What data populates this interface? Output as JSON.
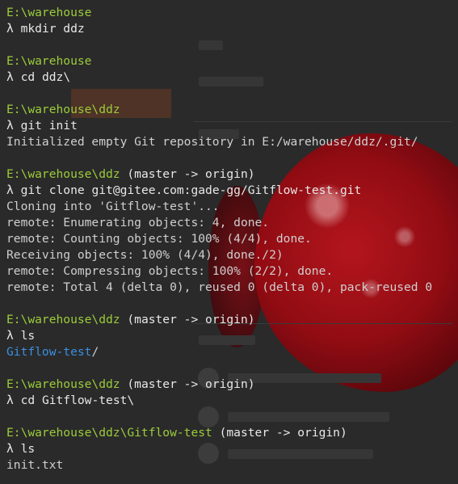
{
  "window": {
    "prompt_symbol": "λ"
  },
  "colors": {
    "background": "#2a2a2a",
    "path": "#9ccc3a",
    "text": "#d6d6d6",
    "directory": "#3b8fe0",
    "apple_red": "#c0141c"
  },
  "session": [
    {
      "type": "path",
      "path": "E:\\warehouse",
      "branch": ""
    },
    {
      "type": "cmd",
      "text": "mkdir ddz"
    },
    {
      "type": "blank"
    },
    {
      "type": "path",
      "path": "E:\\warehouse",
      "branch": ""
    },
    {
      "type": "cmd",
      "text": "cd ddz\\"
    },
    {
      "type": "blank"
    },
    {
      "type": "path",
      "path": "E:\\warehouse\\ddz",
      "branch": ""
    },
    {
      "type": "cmd",
      "text": "git init"
    },
    {
      "type": "out",
      "text": "Initialized empty Git repository in E:/warehouse/ddz/.git/"
    },
    {
      "type": "blank"
    },
    {
      "type": "path",
      "path": "E:\\warehouse\\ddz",
      "branch": " (master -> origin)"
    },
    {
      "type": "cmd",
      "text": "git clone git@gitee.com:gade-gg/Gitflow-test.git"
    },
    {
      "type": "out",
      "text": "Cloning into 'Gitflow-test'..."
    },
    {
      "type": "out",
      "text": "remote: Enumerating objects: 4, done."
    },
    {
      "type": "out",
      "text": "remote: Counting objects: 100% (4/4), done."
    },
    {
      "type": "out",
      "text": "Receiving objects: 100% (4/4), done./2)"
    },
    {
      "type": "out",
      "text": "remote: Compressing objects: 100% (2/2), done."
    },
    {
      "type": "out",
      "text": "remote: Total 4 (delta 0), reused 0 (delta 0), pack-reused 0"
    },
    {
      "type": "blank"
    },
    {
      "type": "path",
      "path": "E:\\warehouse\\ddz",
      "branch": " (master -> origin)"
    },
    {
      "type": "cmd",
      "text": "ls"
    },
    {
      "type": "dir",
      "name": "Gitflow-test",
      "suffix": "/"
    },
    {
      "type": "blank"
    },
    {
      "type": "path",
      "path": "E:\\warehouse\\ddz",
      "branch": " (master -> origin)"
    },
    {
      "type": "cmd",
      "text": "cd Gitflow-test\\"
    },
    {
      "type": "blank"
    },
    {
      "type": "path",
      "path": "E:\\warehouse\\ddz\\Gitflow-test",
      "branch": " (master -> origin)"
    },
    {
      "type": "cmd",
      "text": "ls"
    },
    {
      "type": "out",
      "text": "init.txt"
    }
  ]
}
